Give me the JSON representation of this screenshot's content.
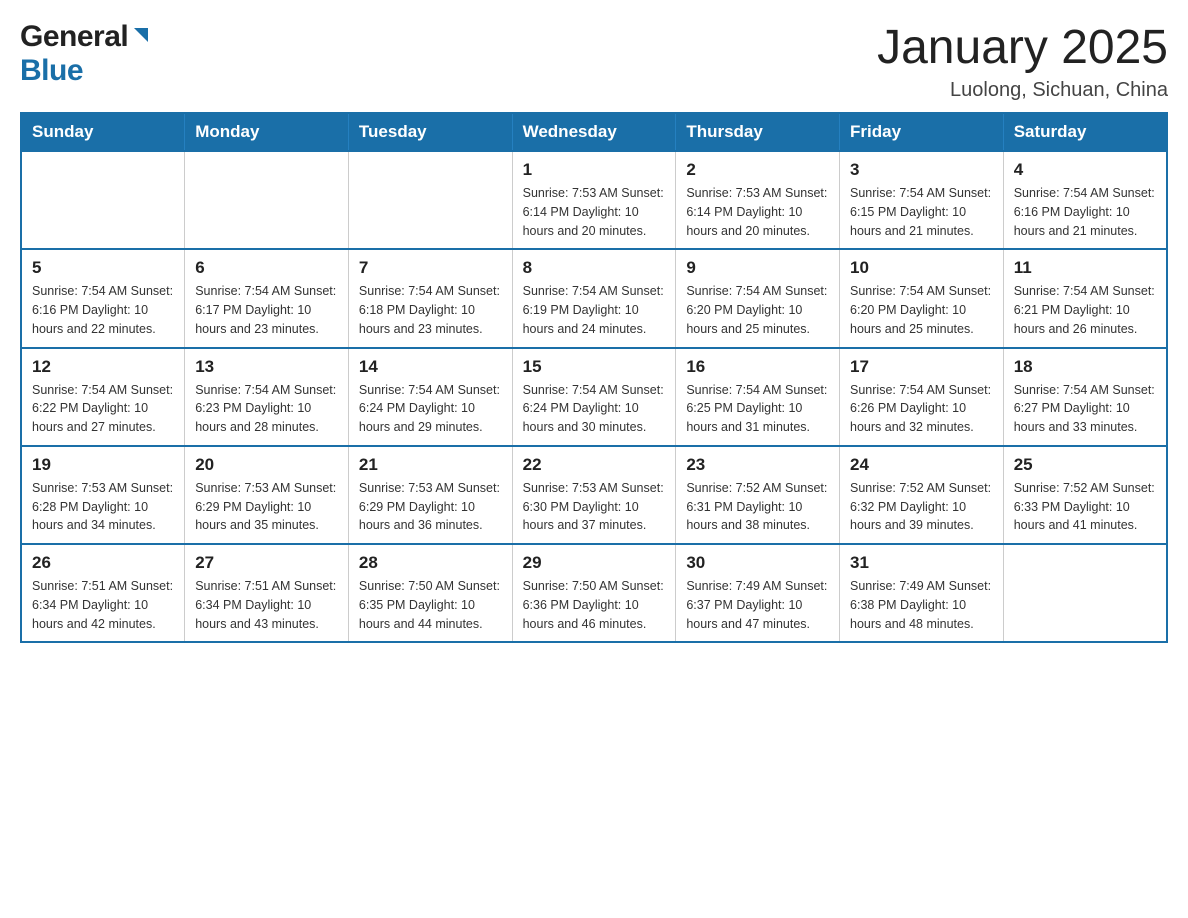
{
  "header": {
    "logo_general": "General",
    "logo_blue": "Blue",
    "month_title": "January 2025",
    "location": "Luolong, Sichuan, China"
  },
  "days_of_week": [
    "Sunday",
    "Monday",
    "Tuesday",
    "Wednesday",
    "Thursday",
    "Friday",
    "Saturday"
  ],
  "weeks": [
    [
      {
        "day": "",
        "info": ""
      },
      {
        "day": "",
        "info": ""
      },
      {
        "day": "",
        "info": ""
      },
      {
        "day": "1",
        "info": "Sunrise: 7:53 AM\nSunset: 6:14 PM\nDaylight: 10 hours\nand 20 minutes."
      },
      {
        "day": "2",
        "info": "Sunrise: 7:53 AM\nSunset: 6:14 PM\nDaylight: 10 hours\nand 20 minutes."
      },
      {
        "day": "3",
        "info": "Sunrise: 7:54 AM\nSunset: 6:15 PM\nDaylight: 10 hours\nand 21 minutes."
      },
      {
        "day": "4",
        "info": "Sunrise: 7:54 AM\nSunset: 6:16 PM\nDaylight: 10 hours\nand 21 minutes."
      }
    ],
    [
      {
        "day": "5",
        "info": "Sunrise: 7:54 AM\nSunset: 6:16 PM\nDaylight: 10 hours\nand 22 minutes."
      },
      {
        "day": "6",
        "info": "Sunrise: 7:54 AM\nSunset: 6:17 PM\nDaylight: 10 hours\nand 23 minutes."
      },
      {
        "day": "7",
        "info": "Sunrise: 7:54 AM\nSunset: 6:18 PM\nDaylight: 10 hours\nand 23 minutes."
      },
      {
        "day": "8",
        "info": "Sunrise: 7:54 AM\nSunset: 6:19 PM\nDaylight: 10 hours\nand 24 minutes."
      },
      {
        "day": "9",
        "info": "Sunrise: 7:54 AM\nSunset: 6:20 PM\nDaylight: 10 hours\nand 25 minutes."
      },
      {
        "day": "10",
        "info": "Sunrise: 7:54 AM\nSunset: 6:20 PM\nDaylight: 10 hours\nand 25 minutes."
      },
      {
        "day": "11",
        "info": "Sunrise: 7:54 AM\nSunset: 6:21 PM\nDaylight: 10 hours\nand 26 minutes."
      }
    ],
    [
      {
        "day": "12",
        "info": "Sunrise: 7:54 AM\nSunset: 6:22 PM\nDaylight: 10 hours\nand 27 minutes."
      },
      {
        "day": "13",
        "info": "Sunrise: 7:54 AM\nSunset: 6:23 PM\nDaylight: 10 hours\nand 28 minutes."
      },
      {
        "day": "14",
        "info": "Sunrise: 7:54 AM\nSunset: 6:24 PM\nDaylight: 10 hours\nand 29 minutes."
      },
      {
        "day": "15",
        "info": "Sunrise: 7:54 AM\nSunset: 6:24 PM\nDaylight: 10 hours\nand 30 minutes."
      },
      {
        "day": "16",
        "info": "Sunrise: 7:54 AM\nSunset: 6:25 PM\nDaylight: 10 hours\nand 31 minutes."
      },
      {
        "day": "17",
        "info": "Sunrise: 7:54 AM\nSunset: 6:26 PM\nDaylight: 10 hours\nand 32 minutes."
      },
      {
        "day": "18",
        "info": "Sunrise: 7:54 AM\nSunset: 6:27 PM\nDaylight: 10 hours\nand 33 minutes."
      }
    ],
    [
      {
        "day": "19",
        "info": "Sunrise: 7:53 AM\nSunset: 6:28 PM\nDaylight: 10 hours\nand 34 minutes."
      },
      {
        "day": "20",
        "info": "Sunrise: 7:53 AM\nSunset: 6:29 PM\nDaylight: 10 hours\nand 35 minutes."
      },
      {
        "day": "21",
        "info": "Sunrise: 7:53 AM\nSunset: 6:29 PM\nDaylight: 10 hours\nand 36 minutes."
      },
      {
        "day": "22",
        "info": "Sunrise: 7:53 AM\nSunset: 6:30 PM\nDaylight: 10 hours\nand 37 minutes."
      },
      {
        "day": "23",
        "info": "Sunrise: 7:52 AM\nSunset: 6:31 PM\nDaylight: 10 hours\nand 38 minutes."
      },
      {
        "day": "24",
        "info": "Sunrise: 7:52 AM\nSunset: 6:32 PM\nDaylight: 10 hours\nand 39 minutes."
      },
      {
        "day": "25",
        "info": "Sunrise: 7:52 AM\nSunset: 6:33 PM\nDaylight: 10 hours\nand 41 minutes."
      }
    ],
    [
      {
        "day": "26",
        "info": "Sunrise: 7:51 AM\nSunset: 6:34 PM\nDaylight: 10 hours\nand 42 minutes."
      },
      {
        "day": "27",
        "info": "Sunrise: 7:51 AM\nSunset: 6:34 PM\nDaylight: 10 hours\nand 43 minutes."
      },
      {
        "day": "28",
        "info": "Sunrise: 7:50 AM\nSunset: 6:35 PM\nDaylight: 10 hours\nand 44 minutes."
      },
      {
        "day": "29",
        "info": "Sunrise: 7:50 AM\nSunset: 6:36 PM\nDaylight: 10 hours\nand 46 minutes."
      },
      {
        "day": "30",
        "info": "Sunrise: 7:49 AM\nSunset: 6:37 PM\nDaylight: 10 hours\nand 47 minutes."
      },
      {
        "day": "31",
        "info": "Sunrise: 7:49 AM\nSunset: 6:38 PM\nDaylight: 10 hours\nand 48 minutes."
      },
      {
        "day": "",
        "info": ""
      }
    ]
  ]
}
